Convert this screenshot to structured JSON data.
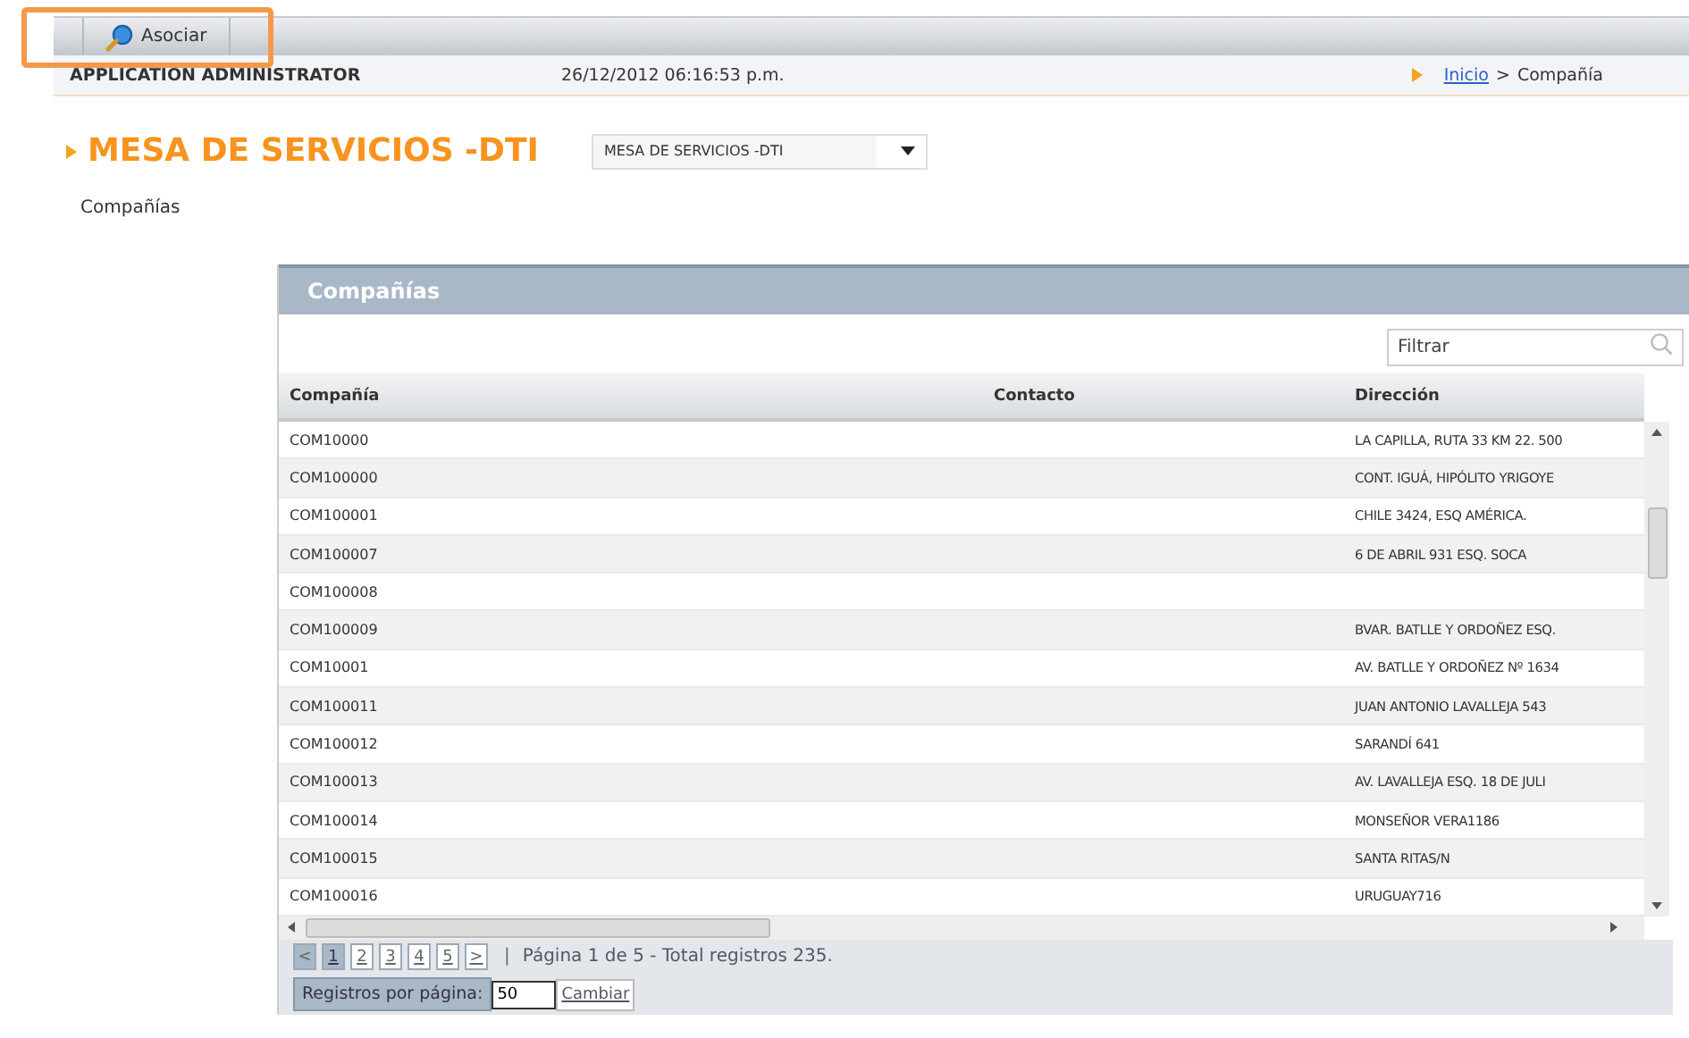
{
  "toolbar": {
    "buttons": [
      {
        "label": "Asociar"
      }
    ]
  },
  "header": {
    "user": "APPLICATION ADMINISTRATOR",
    "datetime": "26/12/2012 06:16:53 p.m.",
    "breadcrumb": {
      "link": "Inicio",
      "separator": ">",
      "current": "Compañía"
    }
  },
  "page": {
    "title": "MESA DE SERVICIOS -DTI",
    "select_value": "MESA DE SERVICIOS -DTI",
    "subtitle": "Compañías"
  },
  "panel": {
    "title": "Compañías",
    "filter": {
      "placeholder": "Filtrar"
    },
    "table": {
      "columns": [
        "Compañía",
        "Contacto",
        "Dirección"
      ],
      "rows": [
        [
          "COM10000",
          "",
          "LA CAPILLA, RUTA 33 KM 22. 500"
        ],
        [
          "COM100000",
          "",
          "CONT. IGUÁ, HIPÓLITO YRIGOYE"
        ],
        [
          "COM100001",
          "",
          "CHILE 3424, ESQ AMÉRICA."
        ],
        [
          "COM100007",
          "",
          "6 DE ABRIL 931 ESQ. SOCA"
        ],
        [
          "COM100008",
          "",
          ""
        ],
        [
          "COM100009",
          "",
          "BVAR. BATLLE Y ORDOÑEZ ESQ."
        ],
        [
          "COM10001",
          "",
          "AV. BATLLE Y ORDOÑEZ Nº 1634"
        ],
        [
          "COM100011",
          "",
          "JUAN ANTONIO LAVALLEJA 543"
        ],
        [
          "COM100012",
          "",
          "SARANDÍ 641"
        ],
        [
          "COM100013",
          "",
          "AV. LAVALLEJA ESQ. 18 DE JULI"
        ],
        [
          "COM100014",
          "",
          "MONSEÑOR VERA1186"
        ],
        [
          "COM100015",
          "",
          "SANTA RITAS/N"
        ],
        [
          "COM100016",
          "",
          "URUGUAY716"
        ]
      ]
    },
    "pager": {
      "prev": "<",
      "pages": [
        {
          "label": "1",
          "selected": true
        },
        {
          "label": "2",
          "selected": false
        },
        {
          "label": "3",
          "selected": false
        },
        {
          "label": "4",
          "selected": false
        },
        {
          "label": "5",
          "selected": false
        }
      ],
      "next": ">",
      "separator": "|",
      "status": "Página 1 de 5 - Total registros 235."
    },
    "page_size": {
      "label": "Registros por página:",
      "value": "50",
      "button": "Cambiar"
    }
  }
}
